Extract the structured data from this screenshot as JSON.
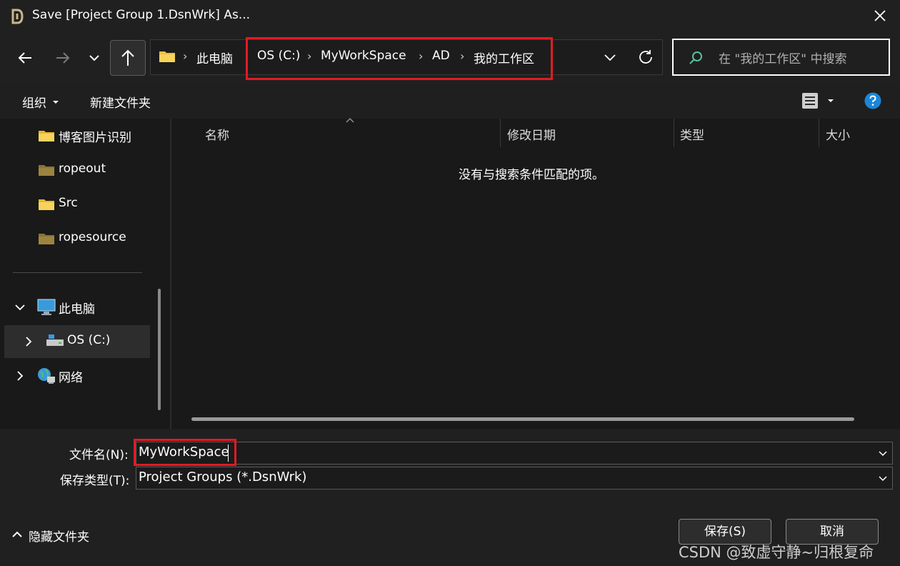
{
  "window": {
    "title": "Save [Project Group 1.DsnWrk] As..."
  },
  "breadcrumb": [
    "此电脑",
    "OS (C:)",
    "MyWorkSpace",
    "AD",
    "我的工作区"
  ],
  "search": {
    "placeholder": "在 \"我的工作区\" 中搜索"
  },
  "toolbar": {
    "organize": "组织",
    "new_folder": "新建文件夹"
  },
  "sidebar": {
    "quick_items": [
      "博客图片识别",
      "ropeout",
      "Src",
      "ropesource"
    ],
    "this_pc": "此电脑",
    "drive": "OS (C:)",
    "network": "网络"
  },
  "columns": [
    "名称",
    "修改日期",
    "类型",
    "大小"
  ],
  "content": {
    "empty_message": "没有与搜索条件匹配的项。"
  },
  "form": {
    "filename_label": "文件名(N):",
    "filename_value": "MyWorkSpace",
    "filetype_label": "保存类型(T):",
    "filetype_value": "Project Groups (*.DsnWrk)"
  },
  "footer": {
    "hide_folders": "隐藏文件夹",
    "save": "保存(S)",
    "cancel": "取消"
  },
  "watermark": "CSDN @致虚守静~归根复命",
  "colors": {
    "highlight_box": "#e01b24",
    "folder_yellow": "#f0c040",
    "help_blue": "#1a86d8"
  }
}
